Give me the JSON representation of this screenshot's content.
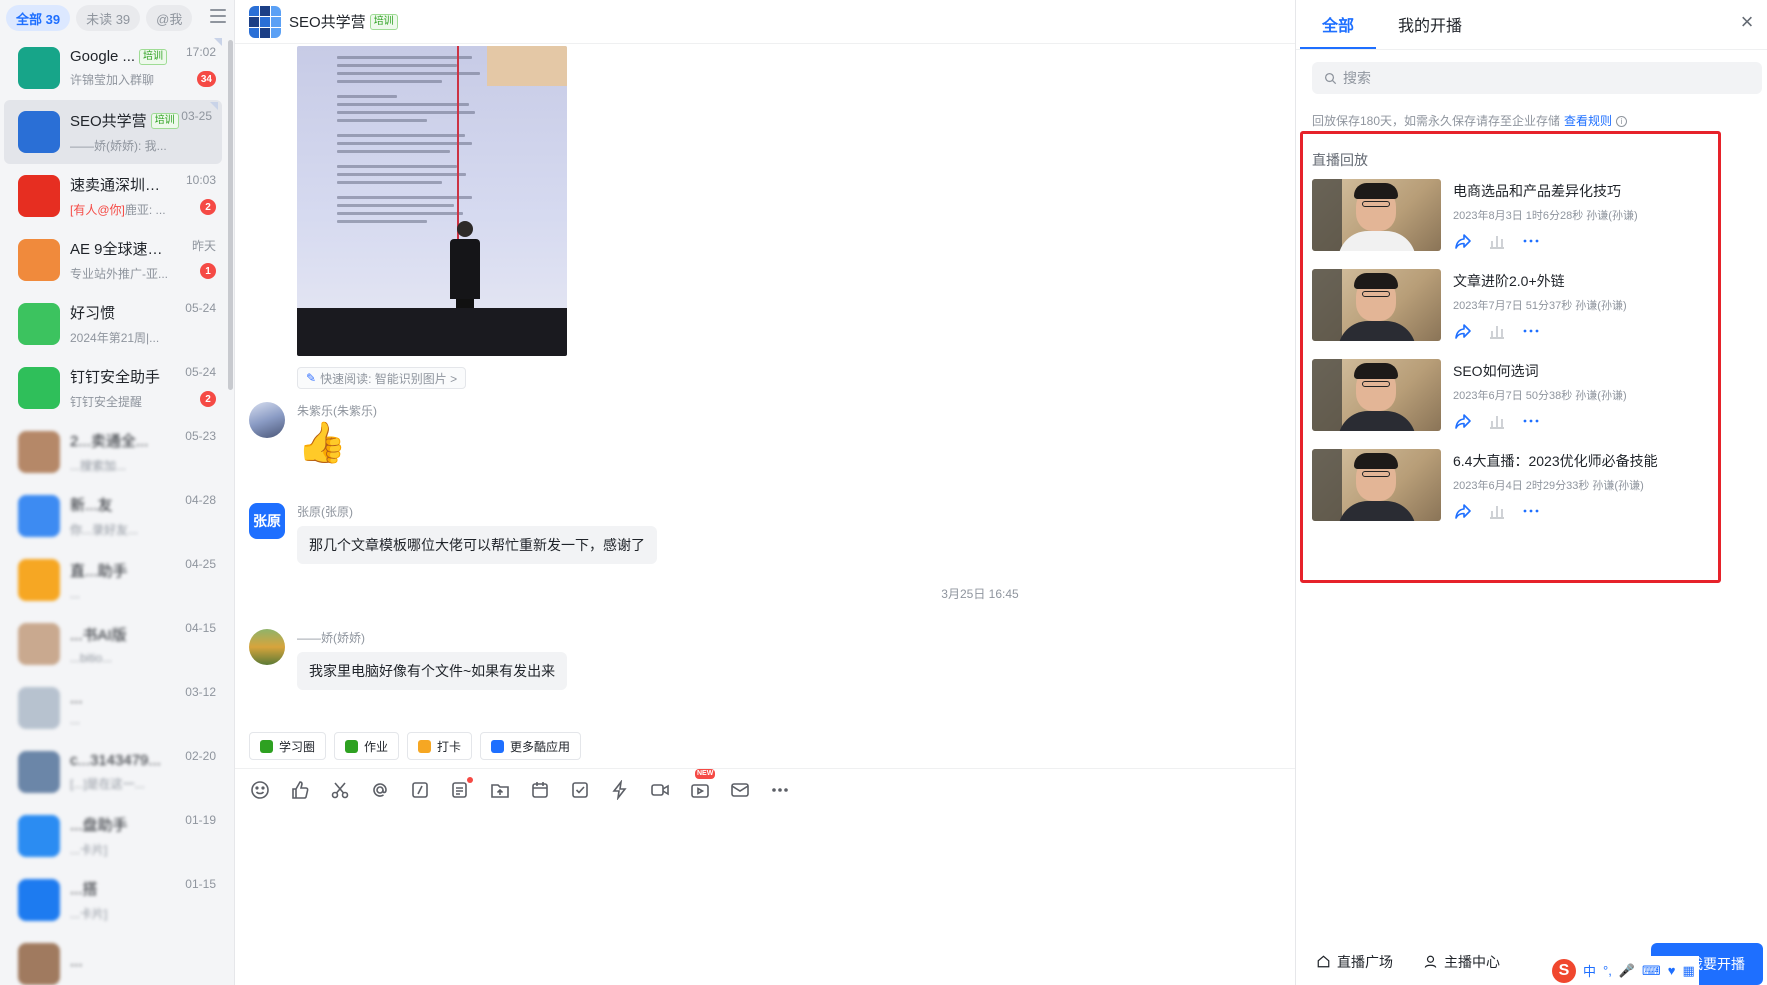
{
  "sidebar": {
    "filters": [
      {
        "label": "全部 39",
        "active": true
      },
      {
        "label": "未读 39",
        "active": false
      },
      {
        "label": "@我",
        "active": false
      }
    ],
    "conversations": [
      {
        "name": "Google ...",
        "tag": "培训",
        "time": "17:02",
        "preview": "许锦莹加入群聊",
        "badge": "34",
        "color": "#17a589",
        "icon": "chat-board-icon",
        "pinned": true
      },
      {
        "name": "SEO共学营",
        "tag": "培训",
        "time": "03-25",
        "preview": "——娇(娇娇): 我...",
        "badge": "",
        "color": "#2a6fd6",
        "icon": "group-grid-icon",
        "pinned": true,
        "active": true
      },
      {
        "name": "速卖通深圳重...",
        "tag": "",
        "time": "10:03",
        "mention": "[有人@你]",
        "preview": "鹿亚: ...",
        "badge": "2",
        "color": "#e62e21",
        "icon": "aliexpress-icon"
      },
      {
        "name": "AE 9全球速卖...",
        "tag": "",
        "time": "昨天",
        "preview": "专业站外推广-亚...",
        "badge": "1",
        "color": "#f08a3c",
        "icon": "layers-icon"
      },
      {
        "name": "好习惯",
        "tag": "",
        "time": "05-24",
        "preview": "2024年第21周|...",
        "badge": "",
        "color": "#3cc35f",
        "icon": "rocket-icon"
      },
      {
        "name": "钉钉安全助手",
        "tag": "",
        "time": "05-24",
        "preview": "钉钉安全提醒",
        "badge": "2",
        "color": "#2fbf5a",
        "icon": "shield-check-icon"
      },
      {
        "name": "2...卖通全...",
        "tag": "",
        "time": "05-23",
        "preview": "...搜索加...",
        "badge": "",
        "color": "#b58868",
        "icon": "group-photo-icon",
        "blurred": true
      },
      {
        "name": "新...友",
        "tag": "",
        "time": "04-28",
        "preview": "你...录好友...",
        "badge": "",
        "color": "#3d8bf2",
        "icon": "contact-icon",
        "blurred": true
      },
      {
        "name": "直...助手",
        "tag": "",
        "time": "04-25",
        "preview": "...",
        "badge": "",
        "color": "#f6a723",
        "icon": "assistant-icon",
        "blurred": true
      },
      {
        "name": "...书AI版",
        "tag": "",
        "time": "04-15",
        "preview": "...bitio...",
        "badge": "",
        "color": "#c9a98f",
        "icon": "person-photo-icon",
        "blurred": true
      },
      {
        "name": "...",
        "tag": "",
        "time": "03-12",
        "preview": "...",
        "badge": "",
        "color": "#b7c2cf",
        "icon": "blurred-avatar-icon",
        "blurred": true
      },
      {
        "name": "c...3143479...",
        "tag": "",
        "time": "02-20",
        "preview": "[...]是在这一...",
        "badge": "",
        "color": "#6b86a8",
        "icon": "group-photo-icon",
        "blurred": true
      },
      {
        "name": "...盘助手",
        "tag": "",
        "time": "01-19",
        "preview": "...卡片]",
        "badge": "",
        "color": "#2b8cf2",
        "icon": "cloud-icon",
        "blurred": true
      },
      {
        "name": "...搭",
        "tag": "",
        "time": "01-15",
        "preview": "...卡片]",
        "badge": "",
        "color": "#1d7bf0",
        "icon": "app-builder-icon",
        "blurred": true
      },
      {
        "name": "...",
        "tag": "",
        "time": "",
        "preview": "",
        "badge": "",
        "color": "#a07a5f",
        "icon": "person-photo-icon",
        "blurred": true
      }
    ]
  },
  "chat": {
    "title": "SEO共学营",
    "title_tag": "培训",
    "quick_read": "快速阅读: 智能识别图片 >",
    "messages": [
      {
        "sender": "朱紫乐(朱紫乐)",
        "type": "sticker",
        "content": "👍"
      },
      {
        "sender": "张原(张原)",
        "avatar_text": "张原",
        "type": "text",
        "content": "那几个文章模板哪位大佬可以帮忙重新发一下，感谢了"
      },
      {
        "sender": "——娇(娇娇)",
        "type": "text",
        "content": "我家里电脑好像有个文件~如果有发出来"
      }
    ],
    "time_divider": "3月25日 16:45",
    "apps": [
      {
        "label": "学习圈",
        "color": "#2ea121"
      },
      {
        "label": "作业",
        "color": "#2ea121"
      },
      {
        "label": "打卡",
        "color": "#f6a723"
      },
      {
        "label": "更多酷应用",
        "color": "#1e6fff"
      }
    ],
    "toolbar_new_tag": "NEW"
  },
  "panel": {
    "tabs": [
      "全部",
      "我的开播"
    ],
    "search_placeholder": "搜索",
    "retention_text": "回放保存180天，如需永久保存请存至企业存储",
    "retention_link": "查看规则",
    "section_title": "直播回放",
    "replays": [
      {
        "title": "电商选品和产品差异化技巧",
        "meta": "2023年8月3日 1时6分28秒 孙谦(孙谦)",
        "shirt": "white"
      },
      {
        "title": "文章进阶2.0+外链",
        "meta": "2023年7月7日 51分37秒 孙谦(孙谦)",
        "shirt": "dark"
      },
      {
        "title": "SEO如何选词",
        "meta": "2023年6月7日 50分38秒 孙谦(孙谦)",
        "shirt": "dark"
      },
      {
        "title": "6.4大直播：2023优化师必备技能",
        "meta": "2023年6月4日 2时29分33秒 孙谦(孙谦)",
        "shirt": "dark"
      }
    ],
    "footer": {
      "plaza": "直播广场",
      "host_center": "主播中心",
      "go_live": "我要开播"
    }
  },
  "ime": {
    "s_label": "S",
    "lang": "中"
  }
}
